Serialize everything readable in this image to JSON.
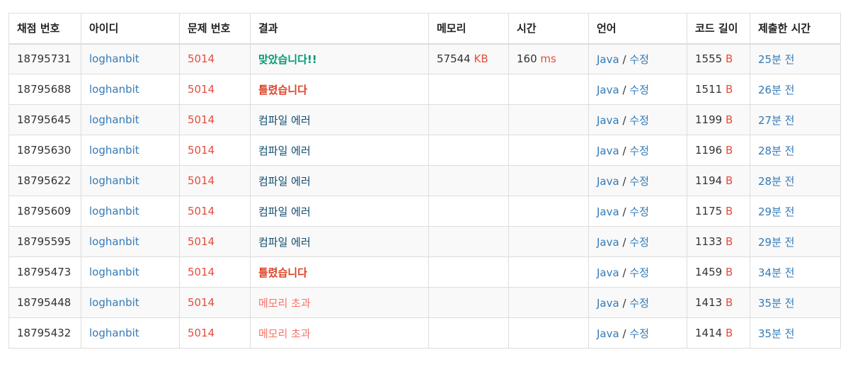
{
  "headers": [
    "채점 번호",
    "아이디",
    "문제 번호",
    "결과",
    "메모리",
    "시간",
    "언어",
    "코드 길이",
    "제출한 시간"
  ],
  "colors": {
    "link": "#337ab7",
    "problem": "#e74c3c",
    "accepted": "#009874",
    "wrong": "#dd4124",
    "compile_error": "#0f4b6e",
    "memory_exceeded": "#fa7268"
  },
  "rows": [
    {
      "id": "18795731",
      "user": "loghanbit",
      "problem": "5014",
      "result": "맞았습니다!!",
      "result_type": "ac",
      "memory": "57544",
      "memory_unit": "KB",
      "time": "160",
      "time_unit": "ms",
      "lang": "Java",
      "lang_sep": "/",
      "edit": "수정",
      "code_len": "1555",
      "code_unit": "B",
      "submitted": "25분 전"
    },
    {
      "id": "18795688",
      "user": "loghanbit",
      "problem": "5014",
      "result": "틀렸습니다",
      "result_type": "wa",
      "memory": "",
      "memory_unit": "",
      "time": "",
      "time_unit": "",
      "lang": "Java",
      "lang_sep": "/",
      "edit": "수정",
      "code_len": "1511",
      "code_unit": "B",
      "submitted": "26분 전"
    },
    {
      "id": "18795645",
      "user": "loghanbit",
      "problem": "5014",
      "result": "컴파일 에러",
      "result_type": "ce",
      "memory": "",
      "memory_unit": "",
      "time": "",
      "time_unit": "",
      "lang": "Java",
      "lang_sep": "/",
      "edit": "수정",
      "code_len": "1199",
      "code_unit": "B",
      "submitted": "27분 전"
    },
    {
      "id": "18795630",
      "user": "loghanbit",
      "problem": "5014",
      "result": "컴파일 에러",
      "result_type": "ce",
      "memory": "",
      "memory_unit": "",
      "time": "",
      "time_unit": "",
      "lang": "Java",
      "lang_sep": "/",
      "edit": "수정",
      "code_len": "1196",
      "code_unit": "B",
      "submitted": "28분 전"
    },
    {
      "id": "18795622",
      "user": "loghanbit",
      "problem": "5014",
      "result": "컴파일 에러",
      "result_type": "ce",
      "memory": "",
      "memory_unit": "",
      "time": "",
      "time_unit": "",
      "lang": "Java",
      "lang_sep": "/",
      "edit": "수정",
      "code_len": "1194",
      "code_unit": "B",
      "submitted": "28분 전"
    },
    {
      "id": "18795609",
      "user": "loghanbit",
      "problem": "5014",
      "result": "컴파일 에러",
      "result_type": "ce",
      "memory": "",
      "memory_unit": "",
      "time": "",
      "time_unit": "",
      "lang": "Java",
      "lang_sep": "/",
      "edit": "수정",
      "code_len": "1175",
      "code_unit": "B",
      "submitted": "29분 전"
    },
    {
      "id": "18795595",
      "user": "loghanbit",
      "problem": "5014",
      "result": "컴파일 에러",
      "result_type": "ce",
      "memory": "",
      "memory_unit": "",
      "time": "",
      "time_unit": "",
      "lang": "Java",
      "lang_sep": "/",
      "edit": "수정",
      "code_len": "1133",
      "code_unit": "B",
      "submitted": "29분 전"
    },
    {
      "id": "18795473",
      "user": "loghanbit",
      "problem": "5014",
      "result": "틀렸습니다",
      "result_type": "wa",
      "memory": "",
      "memory_unit": "",
      "time": "",
      "time_unit": "",
      "lang": "Java",
      "lang_sep": "/",
      "edit": "수정",
      "code_len": "1459",
      "code_unit": "B",
      "submitted": "34분 전"
    },
    {
      "id": "18795448",
      "user": "loghanbit",
      "problem": "5014",
      "result": "메모리 초과",
      "result_type": "mle",
      "memory": "",
      "memory_unit": "",
      "time": "",
      "time_unit": "",
      "lang": "Java",
      "lang_sep": "/",
      "edit": "수정",
      "code_len": "1413",
      "code_unit": "B",
      "submitted": "35분 전"
    },
    {
      "id": "18795432",
      "user": "loghanbit",
      "problem": "5014",
      "result": "메모리 초과",
      "result_type": "mle",
      "memory": "",
      "memory_unit": "",
      "time": "",
      "time_unit": "",
      "lang": "Java",
      "lang_sep": "/",
      "edit": "수정",
      "code_len": "1414",
      "code_unit": "B",
      "submitted": "35분 전"
    }
  ]
}
